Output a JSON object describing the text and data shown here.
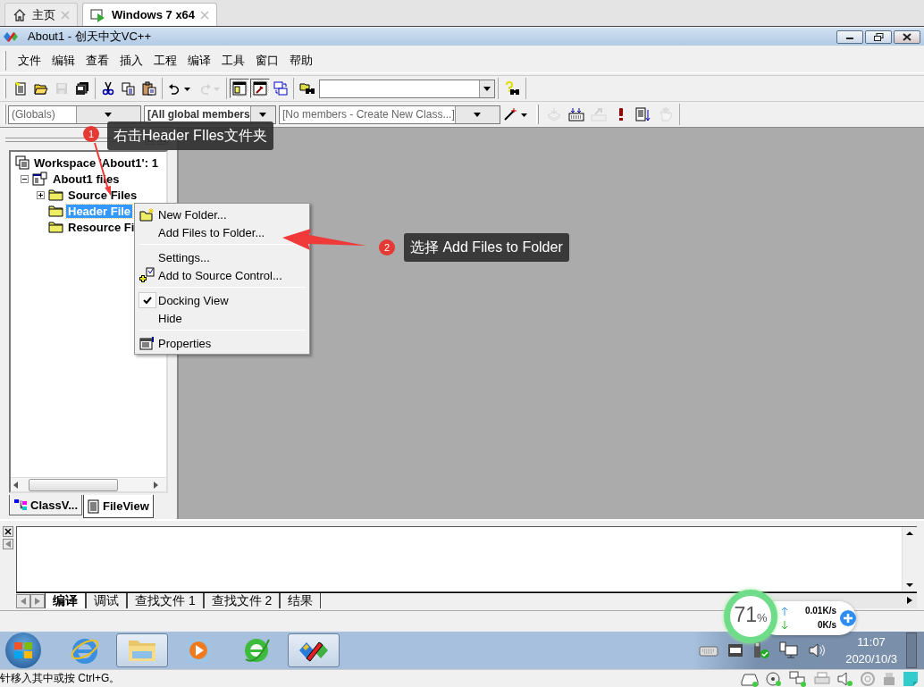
{
  "browser_tabs": [
    {
      "label": "主页",
      "selected": false
    },
    {
      "label": "Windows 7 x64",
      "selected": true
    }
  ],
  "window": {
    "title": "About1 - 创天中文VC++"
  },
  "menu": [
    "文件",
    "编辑",
    "查看",
    "插入",
    "工程",
    "编译",
    "工具",
    "窗口",
    "帮助"
  ],
  "standard_toolbar": [
    [
      {
        "kind": "new",
        "disabled": false,
        "pressed": false
      },
      {
        "kind": "open",
        "disabled": false,
        "pressed": false
      },
      {
        "kind": "save",
        "disabled": true,
        "pressed": false
      },
      {
        "kind": "save_all",
        "disabled": false,
        "pressed": false
      }
    ],
    [
      {
        "kind": "cut",
        "disabled": false,
        "pressed": false
      },
      {
        "kind": "copy",
        "disabled": false,
        "pressed": false
      },
      {
        "kind": "paste",
        "disabled": false,
        "pressed": false
      }
    ],
    [
      {
        "kind": "undo",
        "disabled": false,
        "pressed": false
      },
      {
        "kind": "redo",
        "disabled": true,
        "pressed": false
      }
    ],
    [
      {
        "kind": "workspace",
        "disabled": false,
        "pressed": true
      },
      {
        "kind": "output",
        "disabled": false,
        "pressed": true
      },
      {
        "kind": "windows",
        "disabled": false,
        "pressed": false
      }
    ],
    [
      {
        "kind": "find_in_files",
        "disabled": false,
        "pressed": false
      },
      {
        "kind": "find_combo"
      }
    ],
    [
      {
        "kind": "help",
        "disabled": false,
        "pressed": false
      }
    ]
  ],
  "wizard_bar": {
    "class_combo": "(Globals)",
    "filter_combo": "[All global members",
    "members_combo": "[No members - Create New Class...]"
  },
  "build_toolbar": [
    {
      "kind": "compile",
      "disabled": true
    },
    {
      "kind": "build",
      "disabled": false
    },
    {
      "kind": "stop",
      "disabled": true
    },
    {
      "kind": "execute",
      "disabled": false
    },
    {
      "kind": "go",
      "disabled": false
    },
    {
      "kind": "breakpoint",
      "disabled": true
    }
  ],
  "workspace": {
    "tree": [
      {
        "label": "Workspace 'About1': 1",
        "selected": false,
        "children": [
          {
            "label": "About1 files",
            "selected": false,
            "expanded": true,
            "children": [
              {
                "label": "Source Files",
                "selected": false,
                "expanded": false
              },
              {
                "label": "Header File",
                "selected": true
              },
              {
                "label": "Resource Fi",
                "selected": false
              }
            ]
          }
        ]
      }
    ],
    "tabs": [
      {
        "label": "ClassV...",
        "selected": false
      },
      {
        "label": "FileView",
        "selected": true
      }
    ]
  },
  "context_menu": [
    {
      "kind": "item",
      "label": "New Folder...",
      "checked": false
    },
    {
      "kind": "item",
      "label": "Add Files to Folder...",
      "checked": false
    },
    {
      "kind": "separator"
    },
    {
      "kind": "item",
      "label": "Settings...",
      "checked": false
    },
    {
      "kind": "item",
      "label": "Add to Source Control...",
      "checked": false
    },
    {
      "kind": "separator"
    },
    {
      "kind": "item",
      "label": "Docking View",
      "checked": true
    },
    {
      "kind": "item",
      "label": "Hide",
      "checked": false
    },
    {
      "kind": "separator"
    },
    {
      "kind": "item",
      "label": "Properties",
      "checked": false
    }
  ],
  "annotations": [
    {
      "number": "1",
      "text": "右击Header FIles文件夹"
    },
    {
      "number": "2",
      "text": "选择 Add Files to Folder"
    }
  ],
  "output_panel": {
    "tabs": [
      {
        "label": "编译",
        "selected": true
      },
      {
        "label": "调试",
        "selected": false
      },
      {
        "label": "查找文件 1",
        "selected": false
      },
      {
        "label": "查找文件 2",
        "selected": false
      },
      {
        "label": "结果",
        "selected": false
      }
    ]
  },
  "network_widget": {
    "usage": "71",
    "unit": "%",
    "upload": "0.01K/s",
    "download": "0K/s"
  },
  "taskbar": {
    "apps": [
      {
        "kind": "ie",
        "selected": false
      },
      {
        "kind": "explorer",
        "selected": true
      },
      {
        "kind": "media",
        "selected": false
      },
      {
        "kind": "browser",
        "selected": false
      },
      {
        "kind": "vc",
        "selected": true
      }
    ],
    "time": "11:07",
    "date": "2020/10/3"
  },
  "status_text": "针移入其中或按 Ctrl+G。"
}
